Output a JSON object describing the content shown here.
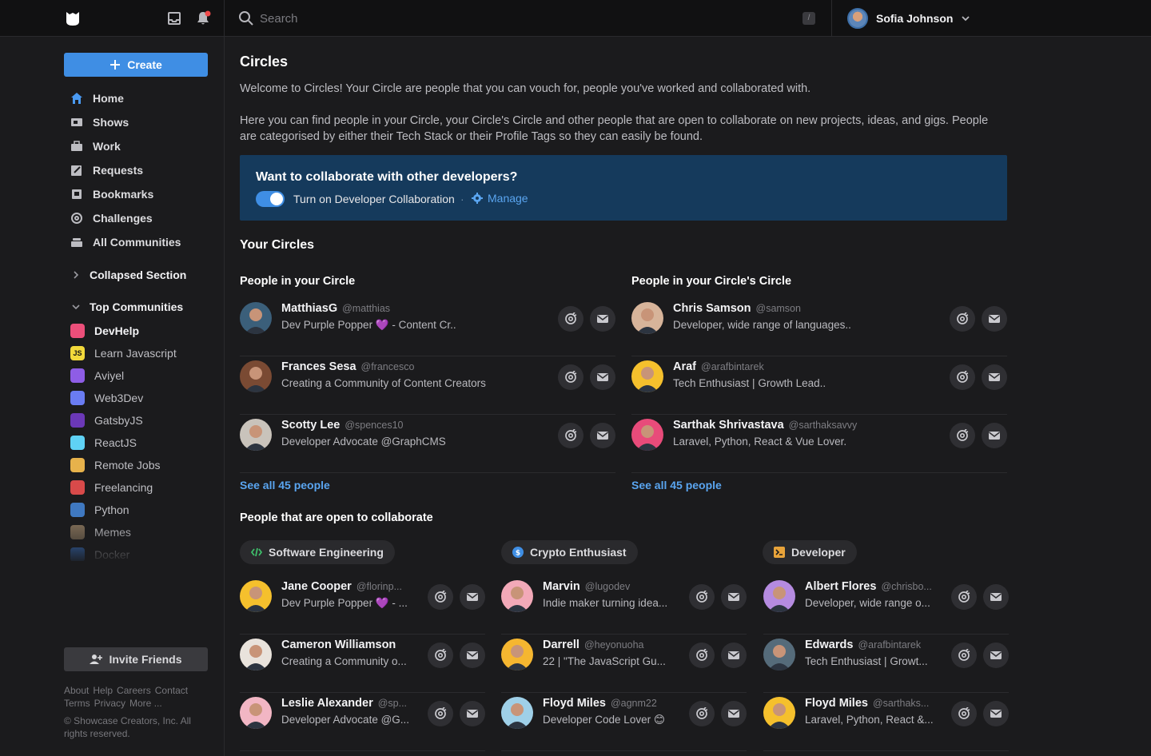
{
  "topbar": {
    "search_placeholder": "Search",
    "search_shortcut": "/",
    "user_name": "Sofia Johnson"
  },
  "sidebar": {
    "create_label": "Create",
    "nav": [
      "Home",
      "Shows",
      "Work",
      "Requests",
      "Bookmarks",
      "Challenges",
      "All Communities"
    ],
    "collapsed_section": "Collapsed Section",
    "top_communities": "Top Communities",
    "communities": [
      {
        "name": "DevHelp",
        "color": "#ec4f7a"
      },
      {
        "name": "Learn Javascript",
        "color": "#f2d93b",
        "label": "JS"
      },
      {
        "name": "Aviyel",
        "color": "#8e5de6"
      },
      {
        "name": "Web3Dev",
        "color": "#6a7cf2"
      },
      {
        "name": "GatsbyJS",
        "color": "#6b38b7"
      },
      {
        "name": "ReactJS",
        "color": "#5fd2f5"
      },
      {
        "name": "Remote Jobs",
        "color": "#e7b24b"
      },
      {
        "name": "Freelancing",
        "color": "#d84a4a"
      },
      {
        "name": "Python",
        "color": "#3f78c0"
      },
      {
        "name": "Memes",
        "color": "#7b6a55"
      },
      {
        "name": "Docker",
        "color": "#3a7bd5"
      }
    ],
    "invite_label": "Invite Friends",
    "footer_links": [
      "About",
      "Help",
      "Careers",
      "Contact",
      "Terms",
      "Privacy",
      "More ..."
    ],
    "copyright": "© Showcase Creators, Inc. All rights reserved."
  },
  "main": {
    "title": "Circles",
    "intro1": "Welcome to Circles! Your Circle are people that you can vouch for, people you've worked and collaborated with.",
    "intro2": "Here you can find people in your Circle, your Circle's Circle and other people that are open to collaborate on new projects, ideas, and gigs. People are categorised by either their Tech Stack or their Profile Tags so they can easily be found.",
    "banner": {
      "title": "Want to collaborate with other developers?",
      "toggle_label": "Turn on Developer Collaboration",
      "separator": "·",
      "manage_label": "Manage"
    },
    "your_circles": "Your Circles",
    "circle_col": {
      "title": "People in your Circle",
      "see_all": "See all 45 people",
      "people": [
        {
          "name": "MatthiasG",
          "handle": "@matthias",
          "desc": "Dev Purple Popper 💜 - Content Cr..",
          "color": "#3b5f7a"
        },
        {
          "name": "Frances Sesa",
          "handle": "@francesco",
          "desc": "Creating a Community of Content Creators",
          "color": "#7a4a33"
        },
        {
          "name": "Scotty Lee",
          "handle": "@spences10",
          "desc": "Developer Advocate @GraphCMS",
          "color": "#c9c3bb"
        }
      ]
    },
    "circles_circle_col": {
      "title": "People in your Circle's Circle",
      "see_all": "See all 45 people",
      "people": [
        {
          "name": "Chris Samson",
          "handle": "@samson",
          "desc": "Developer, wide range of languages..",
          "color": "#d7b49a"
        },
        {
          "name": "Araf",
          "handle": "@arafbintarek",
          "desc": "Tech Enthusiast | Growth Lead..",
          "color": "#f5c02d"
        },
        {
          "name": "Sarthak Shrivastava",
          "handle": "@sarthaksavvy",
          "desc": "Laravel, Python, React & Vue Lover.",
          "color": "#e84b7a"
        }
      ]
    },
    "open_title": "People that are open to collaborate",
    "groups": [
      {
        "tag": "Software Engineering",
        "tag_color": "#3fbf6b",
        "people": [
          {
            "name": "Jane Cooper",
            "handle": "@florinp...",
            "desc": "Dev Purple Popper 💜 - ...",
            "color": "#f5c02d"
          },
          {
            "name": "Cameron Williamson",
            "handle": "",
            "desc": "Creating a Community o...",
            "color": "#e9e3dc"
          },
          {
            "name": "Leslie Alexander",
            "handle": "@sp...",
            "desc": "Developer Advocate @G...",
            "color": "#f2b6c4"
          }
        ]
      },
      {
        "tag": "Crypto Enthusiast",
        "tag_color": "#3f8ee4",
        "people": [
          {
            "name": "Marvin",
            "handle": "@lugodev",
            "desc": "Indie maker turning idea...",
            "color": "#f2a9b8"
          },
          {
            "name": "Darrell",
            "handle": "@heyonuoha",
            "desc": "22 | \"The JavaScript Gu...",
            "color": "#f5b630"
          },
          {
            "name": "Floyd Miles",
            "handle": "@agnm22",
            "desc": "Developer Code Lover 😊",
            "color": "#9fd0e8"
          }
        ]
      },
      {
        "tag": "Developer",
        "tag_color": "#e8a33a",
        "people": [
          {
            "name": "Albert Flores",
            "handle": "@chrisbo...",
            "desc": "Developer, wide range o...",
            "color": "#b58be0"
          },
          {
            "name": "Edwards",
            "handle": "@arafbintarek",
            "desc": "Tech Enthusiast | Growt...",
            "color": "#556b7a"
          },
          {
            "name": "Floyd Miles",
            "handle": "@sarthaks...",
            "desc": "Laravel, Python, React &...",
            "color": "#f5c02d"
          }
        ]
      }
    ]
  }
}
